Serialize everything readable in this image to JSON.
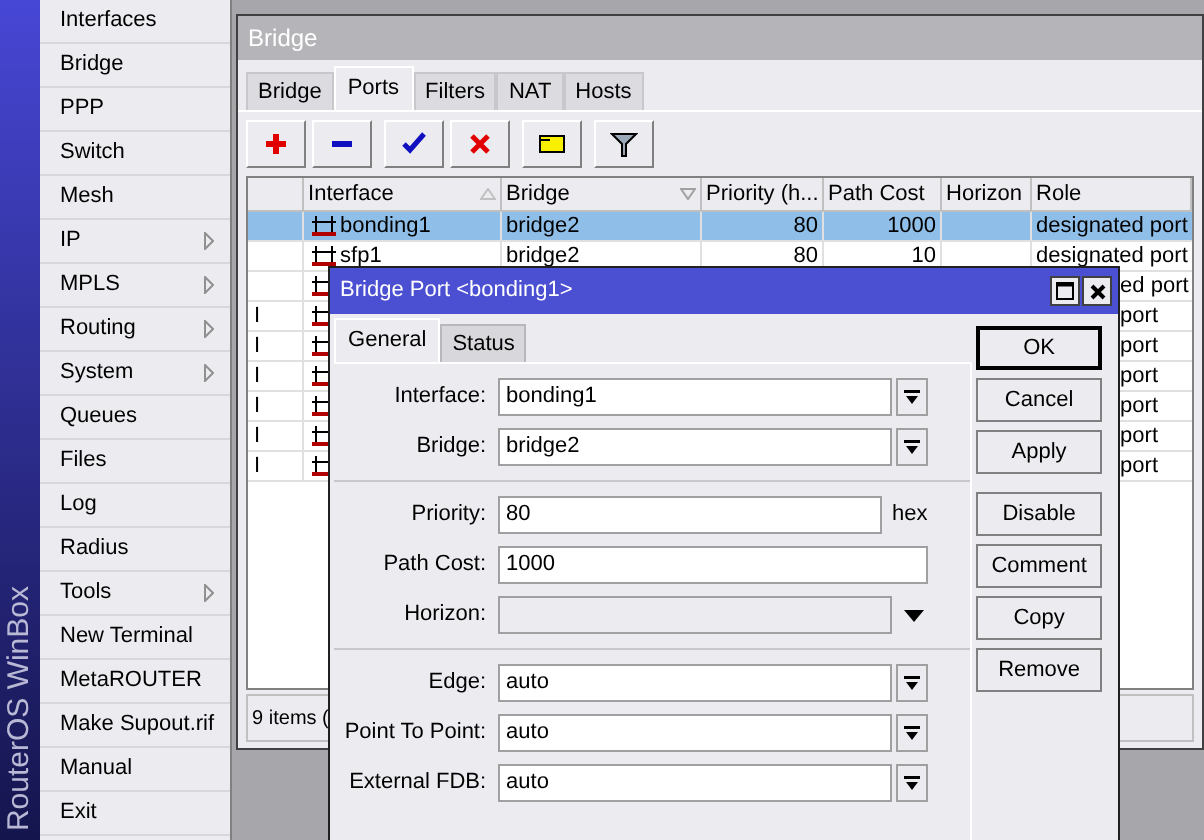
{
  "sidebar": {
    "brand": "RouterOS WinBox",
    "items": [
      {
        "label": "Interfaces",
        "submenu": false
      },
      {
        "label": "Bridge",
        "submenu": false
      },
      {
        "label": "PPP",
        "submenu": false
      },
      {
        "label": "Switch",
        "submenu": false
      },
      {
        "label": "Mesh",
        "submenu": false
      },
      {
        "label": "IP",
        "submenu": true
      },
      {
        "label": "MPLS",
        "submenu": true
      },
      {
        "label": "Routing",
        "submenu": true
      },
      {
        "label": "System",
        "submenu": true
      },
      {
        "label": "Queues",
        "submenu": false
      },
      {
        "label": "Files",
        "submenu": false
      },
      {
        "label": "Log",
        "submenu": false
      },
      {
        "label": "Radius",
        "submenu": false
      },
      {
        "label": "Tools",
        "submenu": true
      },
      {
        "label": "New Terminal",
        "submenu": false
      },
      {
        "label": "MetaROUTER",
        "submenu": false
      },
      {
        "label": "Make Supout.rif",
        "submenu": false
      },
      {
        "label": "Manual",
        "submenu": false
      },
      {
        "label": "Exit",
        "submenu": false
      }
    ]
  },
  "bridge_window": {
    "title": "Bridge",
    "tabs": [
      {
        "label": "Bridge",
        "selected": false
      },
      {
        "label": "Ports",
        "selected": true
      },
      {
        "label": "Filters",
        "selected": false
      },
      {
        "label": "NAT",
        "selected": false
      },
      {
        "label": "Hosts",
        "selected": false
      }
    ],
    "toolbar": [
      {
        "kind": "add"
      },
      {
        "kind": "remove"
      },
      {
        "kind": "enable"
      },
      {
        "kind": "disable"
      },
      {
        "kind": "comment"
      },
      {
        "kind": "filter"
      }
    ],
    "table": {
      "columns": [
        {
          "label": "Interface",
          "sorted": true,
          "descending": false
        },
        {
          "label": "Bridge",
          "sorted": true,
          "descending": true
        },
        {
          "label": "Priority (h...",
          "sorted": false
        },
        {
          "label": "Path Cost",
          "sorted": false
        },
        {
          "label": "Horizon",
          "sorted": false
        },
        {
          "label": "Role",
          "sorted": false
        }
      ],
      "rows": [
        {
          "selected": true,
          "flag": "",
          "interface": "bonding1",
          "bridge": "bridge2",
          "priority": "80",
          "path_cost": "1000",
          "role": "designated port"
        },
        {
          "selected": false,
          "flag": "",
          "interface": "sfp1",
          "bridge": "bridge2",
          "priority": "80",
          "path_cost": "10",
          "role": "designated port"
        },
        {
          "selected": false,
          "flag": "",
          "role": "ed port"
        },
        {
          "selected": false,
          "flag": "I",
          "role": "port"
        },
        {
          "selected": false,
          "flag": "I",
          "role": "port"
        },
        {
          "selected": false,
          "flag": "I",
          "role": "port"
        },
        {
          "selected": false,
          "flag": "I",
          "role": "port"
        },
        {
          "selected": false,
          "flag": "I",
          "role": "port"
        },
        {
          "selected": false,
          "flag": "I",
          "role": "port"
        }
      ]
    },
    "status_bar": "9 items ("
  },
  "dialog": {
    "title": "Bridge Port <bonding1>",
    "tabs": [
      {
        "label": "General",
        "selected": true
      },
      {
        "label": "Status",
        "selected": false
      }
    ],
    "field_groups": [
      [
        {
          "label": "Interface:",
          "value": "bonding1",
          "kind": "dropdown",
          "disabled": false
        },
        {
          "label": "Bridge:",
          "value": "bridge2",
          "kind": "dropdown",
          "disabled": false
        }
      ],
      [
        {
          "label": "Priority:",
          "value": "80",
          "kind": "text",
          "suffix": "hex",
          "disabled": false
        },
        {
          "label": "Path Cost:",
          "value": "1000",
          "kind": "text",
          "disabled": false
        },
        {
          "label": "Horizon:",
          "kind": "combo",
          "disabled": true
        }
      ],
      [
        {
          "label": "Edge:",
          "value": "auto",
          "kind": "dropdown",
          "disabled": false
        },
        {
          "label": "Point To Point:",
          "value": "auto",
          "kind": "dropdown",
          "disabled": false
        },
        {
          "label": "External FDB:",
          "value": "auto",
          "kind": "dropdown",
          "disabled": false
        }
      ]
    ],
    "button_groups": [
      [
        {
          "label": "OK",
          "default": true
        },
        {
          "label": "Cancel",
          "default": false
        },
        {
          "label": "Apply",
          "default": false
        }
      ],
      [
        {
          "label": "Disable",
          "default": false
        },
        {
          "label": "Comment",
          "default": false
        },
        {
          "label": "Copy",
          "default": false
        },
        {
          "label": "Remove",
          "default": false
        }
      ]
    ]
  }
}
